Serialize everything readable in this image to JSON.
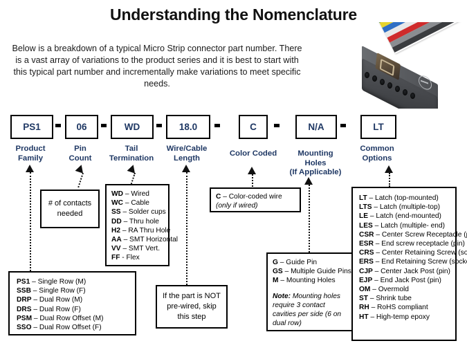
{
  "header": {
    "title": "Understanding the Nomenclature",
    "intro": "Below is a breakdown of a typical Micro Strip connector part number. There is a vast array of variations to the product series and it is best to start with this typical part number and incrementally make variations to meet specific needs."
  },
  "photo": {
    "alt": "micro-strip-connector-with-ribbon-cable",
    "ribbon_colors": [
      "#3f8f45",
      "#e6d42e",
      "#2f6fc4",
      "#e8e8e8",
      "#cf2b2b",
      "#8a8d91",
      "#3a3c3f"
    ],
    "body_color": "#46484c"
  },
  "part_number": {
    "segments": [
      {
        "value": "PS1",
        "label": "Product\nFamily",
        "label_line1": "Product",
        "label_line2": "Family"
      },
      {
        "value": "06",
        "label": "Pin Count",
        "label_line1": "Pin",
        "label_line2": "Count"
      },
      {
        "value": "WD",
        "label": "Tail Termination",
        "label_line1": "Tail",
        "label_line2": "Termination"
      },
      {
        "value": "18.0",
        "label": "Wire/Cable Length",
        "label_line1": "Wire/Cable",
        "label_line2": "Length"
      },
      {
        "value": "C",
        "label": "Color Coded",
        "label_line1": "Color Coded",
        "label_line2": ""
      },
      {
        "value": "N/A",
        "label": "Mounting Holes (If Applicable)",
        "label_line1": "Mounting",
        "label_line2": "Holes",
        "label_line3": "(If Applicable)"
      },
      {
        "value": "LT",
        "label": "Common Options",
        "label_line1": "Common",
        "label_line2": "Options"
      }
    ],
    "separator": "-",
    "text_color": "#1f3864"
  },
  "details": {
    "product_family": {
      "items": [
        {
          "code": "PS1",
          "desc": "– Single Row (M)"
        },
        {
          "code": "SSB",
          "desc": "– Single Row (F)"
        },
        {
          "code": "DRP",
          "desc": "– Dual Row (M)"
        },
        {
          "code": "DRS",
          "desc": "– Dual Row (F)"
        },
        {
          "code": "PSM",
          "desc": "– Dual Row Offset (M)"
        },
        {
          "code": "SSO",
          "desc": "– Dual Row Offset (F)"
        }
      ]
    },
    "pin_count": {
      "line1": "# of contacts",
      "line2": "needed",
      "text": "# of contacts needed"
    },
    "tail_termination": {
      "items": [
        {
          "code": "WD",
          "desc": "– Wired"
        },
        {
          "code": "WC",
          "desc": "– Cable"
        },
        {
          "code": "SS",
          "desc": "– Solder cups"
        },
        {
          "code": "DD",
          "desc": "– Thru hole"
        },
        {
          "code": "H2",
          "desc": "– RA Thru Hole"
        },
        {
          "code": "AA",
          "desc": "– SMT Horizontal"
        },
        {
          "code": "VV",
          "desc": "– SMT Vert."
        },
        {
          "code": "FF",
          "desc": "- Flex"
        }
      ]
    },
    "wire_cable_length": {
      "line1": "If the part is NOT",
      "line2": "pre-wired, skip",
      "line3": "this step",
      "text": "If the part is NOT pre-wired, skip this step"
    },
    "color_coded": {
      "item_code": "C",
      "item_desc": "– Color-coded wire",
      "note": "(only if wired)"
    },
    "mounting_holes": {
      "items": [
        {
          "code": "G",
          "desc": "– Guide Pin"
        },
        {
          "code": "GS",
          "desc": "– Multiple Guide Pins"
        },
        {
          "code": "M",
          "desc": "– Mounting Holes"
        }
      ],
      "note_label": "Note:",
      "note_text": "Mounting holes require 3 contact cavities per side (6 on dual row)"
    },
    "common_options": {
      "items": [
        {
          "code": "LT",
          "desc": "– Latch (top-mounted)"
        },
        {
          "code": "LTS",
          "desc": "– Latch (multiple-top)"
        },
        {
          "code": "LE",
          "desc": "– Latch (end-mounted)"
        },
        {
          "code": "LES",
          "desc": "– Latch (multiple- end)"
        },
        {
          "code": "CSR",
          "desc": "– Center Screw Receptacle (pin)"
        },
        {
          "code": "ESR",
          "desc": "– End screw receptacle (pin)"
        },
        {
          "code": "CRS",
          "desc": "– Center Retaining Screw (socket)"
        },
        {
          "code": "ERS",
          "desc": "– End Retaining Screw (socket)"
        },
        {
          "code": "CJP",
          "desc": "– Center Jack Post (pin)"
        },
        {
          "code": "EJP",
          "desc": "– End Jack Post (pin)"
        },
        {
          "code": "OM",
          "desc": "– Overmold"
        },
        {
          "code": "ST",
          "desc": "– Shrink tube"
        },
        {
          "code": "RH",
          "desc": "– RoHS compliant"
        },
        {
          "code": "HT",
          "desc": "– High-temp epoxy"
        }
      ]
    }
  }
}
